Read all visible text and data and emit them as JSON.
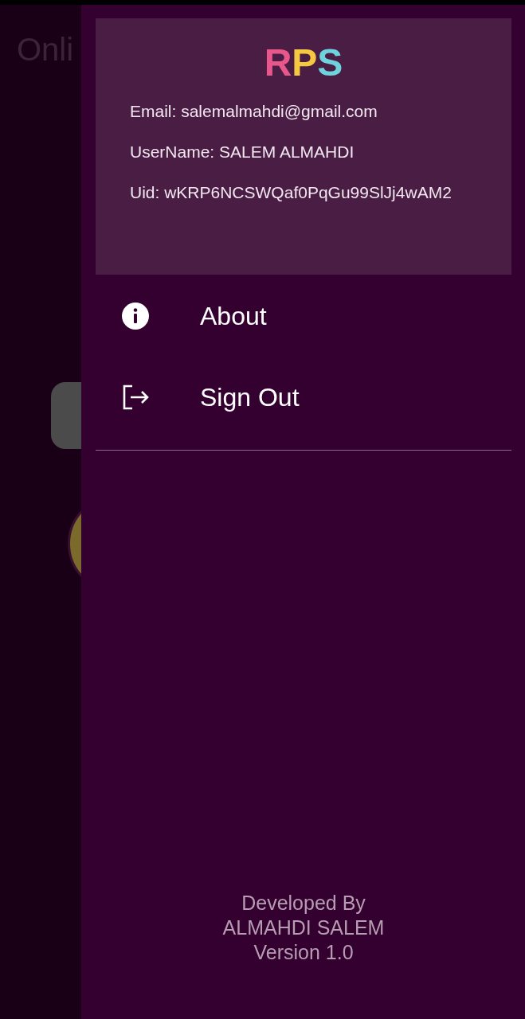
{
  "background_screen": {
    "title": "Onli"
  },
  "drawer": {
    "logo": [
      {
        "text": "R",
        "color": "#e8578b"
      },
      {
        "text": "P",
        "color": "#f5c842"
      },
      {
        "text": "S",
        "color": "#6fd3dd"
      }
    ],
    "account_lines": [
      "Email: salemalmahdi@gmail.com",
      "UserName: SALEM ALMAHDI",
      "Uid: wKRP6NCSWQaf0PqGu99SlJj4wAM2"
    ],
    "menu": [
      {
        "label": "About",
        "kind": "info"
      },
      {
        "label": "Sign Out",
        "kind": "sign-out"
      }
    ],
    "footer": [
      "Developed By",
      "ALMAHDI SALEM",
      "Version 1.0"
    ]
  }
}
